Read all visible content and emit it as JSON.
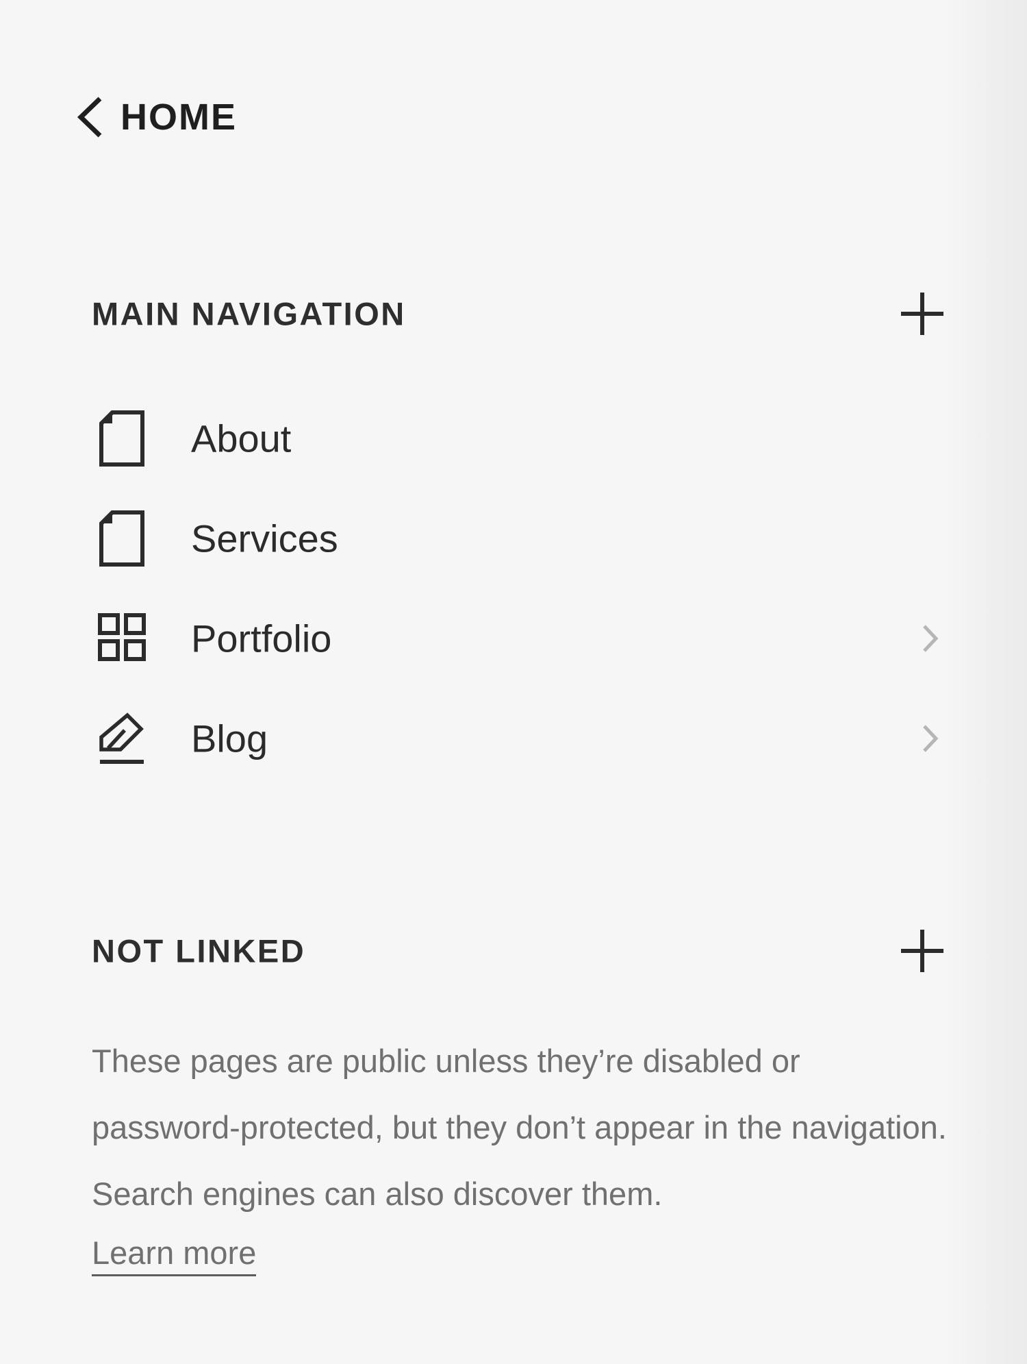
{
  "home": {
    "label": "HOME",
    "icon": "chevron-left-icon"
  },
  "main_navigation": {
    "title": "MAIN NAVIGATION",
    "add_icon": "plus-icon",
    "items": [
      {
        "label": "About",
        "icon": "page-icon",
        "has_children": false
      },
      {
        "label": "Services",
        "icon": "page-icon",
        "has_children": false
      },
      {
        "label": "Portfolio",
        "icon": "grid-icon",
        "has_children": true
      },
      {
        "label": "Blog",
        "icon": "blog-pencil-icon",
        "has_children": true
      }
    ]
  },
  "not_linked": {
    "title": "NOT LINKED",
    "add_icon": "plus-icon",
    "description": "These pages are public unless they’re disabled or password-protected, but they don’t appear in the navigation. Search engines can also discover them.",
    "learn_more": "Learn more"
  },
  "colors": {
    "background": "#f6f6f6",
    "text_primary": "#2b2b2b",
    "text_secondary": "#707070",
    "chevron_light": "#b5b5b5"
  }
}
